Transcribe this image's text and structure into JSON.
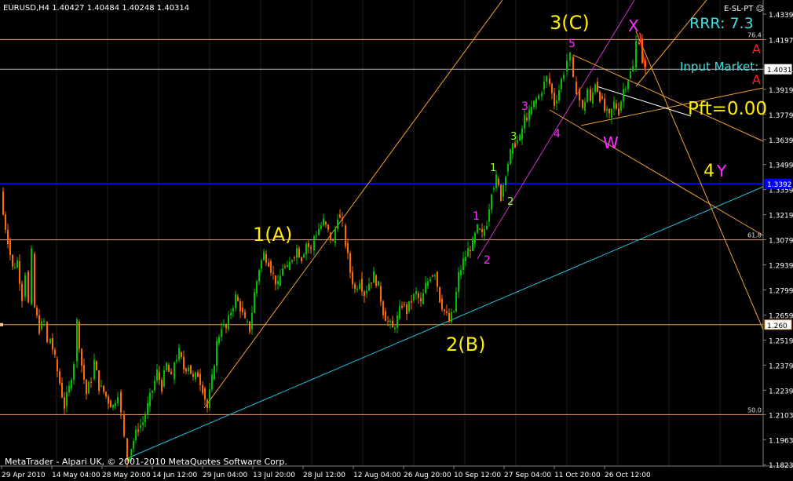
{
  "header": {
    "symbol_info": "EURUSD,H4  1.40427 1.40484 1.40248 1.40314",
    "indicator_label": "E-SL-PT ☺"
  },
  "rrr_label": "RRR: 7.3",
  "input_market_label": "Input Market:",
  "pft_label": "Pft=0.00",
  "watermark": "MetaTrader - Alpari UK, © 2001-2010 MetaQuotes Software Corp.",
  "colors": {
    "background": "#000000",
    "grid": "#1e1e1e",
    "bull_candle": "#00c000",
    "bear_candle": "#ff6a00",
    "fib_line": "#e9a07a",
    "support_line": "#20c0e0",
    "channel_line": "#f0a030",
    "magenta_line": "#d030d0",
    "blue_level": "#0000ff",
    "wave_major": "#ffee00",
    "wave_minor": "#ff30ff",
    "wave_green": "#90ff30",
    "arrow_red": "#ff2020",
    "rrr": "#40e0e0"
  },
  "chart_data": {
    "type": "candlestick",
    "symbol": "EURUSD",
    "timeframe": "H4",
    "ohlc_last": {
      "open": 1.40427,
      "high": 1.40484,
      "low": 1.40248,
      "close": 1.40314
    },
    "ylim": [
      1.1824,
      1.4339
    ],
    "y_ticks": [
      "1.43390",
      "1.41970",
      "1.40314",
      "1.39190",
      "1.37790",
      "1.36390",
      "1.34990",
      "1.33590",
      "1.32190",
      "1.30790",
      "1.29390",
      "1.27990",
      "1.26590",
      "1.25190",
      "1.23790",
      "1.22390",
      "1.21030",
      "1.19630",
      "1.18230"
    ],
    "x_ticks": [
      "29 Apr 2010",
      "14 May 04:00",
      "28 May 20:00",
      "14 Jun 12:00",
      "29 Jun 04:00",
      "13 Jul 20:00",
      "28 Jul 12:00",
      "12 Aug 04:00",
      "26 Aug 20:00",
      "10 Sep 12:00",
      "27 Sep 04:00",
      "11 Oct 20:00",
      "26 Oct 12:00"
    ],
    "price_path": [
      [
        0,
        1.335
      ],
      [
        4,
        1.322
      ],
      [
        10,
        1.308
      ],
      [
        16,
        1.292
      ],
      [
        22,
        1.296
      ],
      [
        28,
        1.276
      ],
      [
        32,
        1.29
      ],
      [
        36,
        1.272
      ],
      [
        40,
        1.3
      ],
      [
        44,
        1.27
      ],
      [
        50,
        1.258
      ],
      [
        56,
        1.262
      ],
      [
        60,
        1.25
      ],
      [
        64,
        1.253
      ],
      [
        70,
        1.241
      ],
      [
        76,
        1.228
      ],
      [
        82,
        1.215
      ],
      [
        88,
        1.225
      ],
      [
        94,
        1.24
      ],
      [
        98,
        1.262
      ],
      [
        104,
        1.238
      ],
      [
        110,
        1.222
      ],
      [
        116,
        1.23
      ],
      [
        120,
        1.24
      ],
      [
        126,
        1.226
      ],
      [
        132,
        1.223
      ],
      [
        138,
        1.218
      ],
      [
        144,
        1.215
      ],
      [
        150,
        1.223
      ],
      [
        154,
        1.21
      ],
      [
        158,
        1.197
      ],
      [
        162,
        1.185
      ],
      [
        170,
        1.196
      ],
      [
        176,
        1.203
      ],
      [
        182,
        1.206
      ],
      [
        188,
        1.215
      ],
      [
        194,
        1.224
      ],
      [
        200,
        1.234
      ],
      [
        206,
        1.226
      ],
      [
        212,
        1.238
      ],
      [
        218,
        1.23
      ],
      [
        222,
        1.24
      ],
      [
        228,
        1.245
      ],
      [
        234,
        1.236
      ],
      [
        240,
        1.238
      ],
      [
        246,
        1.23
      ],
      [
        252,
        1.233
      ],
      [
        258,
        1.225
      ],
      [
        264,
        1.214
      ],
      [
        270,
        1.23
      ],
      [
        276,
        1.25
      ],
      [
        282,
        1.26
      ],
      [
        288,
        1.258
      ],
      [
        294,
        1.268
      ],
      [
        300,
        1.276
      ],
      [
        306,
        1.27
      ],
      [
        312,
        1.262
      ],
      [
        318,
        1.258
      ],
      [
        324,
        1.278
      ],
      [
        330,
        1.292
      ],
      [
        336,
        1.3
      ],
      [
        342,
        1.296
      ],
      [
        348,
        1.288
      ],
      [
        354,
        1.282
      ],
      [
        360,
        1.293
      ],
      [
        366,
        1.291
      ],
      [
        372,
        1.298
      ],
      [
        378,
        1.303
      ],
      [
        384,
        1.298
      ],
      [
        390,
        1.306
      ],
      [
        396,
        1.302
      ],
      [
        400,
        1.31
      ],
      [
        406,
        1.314
      ],
      [
        412,
        1.318
      ],
      [
        418,
        1.312
      ],
      [
        424,
        1.306
      ],
      [
        430,
        1.322
      ],
      [
        436,
        1.316
      ],
      [
        440,
        1.306
      ],
      [
        446,
        1.29
      ],
      [
        452,
        1.28
      ],
      [
        458,
        1.286
      ],
      [
        464,
        1.278
      ],
      [
        470,
        1.284
      ],
      [
        476,
        1.288
      ],
      [
        482,
        1.282
      ],
      [
        488,
        1.268
      ],
      [
        494,
        1.262
      ],
      [
        500,
        1.258
      ],
      [
        506,
        1.264
      ],
      [
        512,
        1.272
      ],
      [
        518,
        1.268
      ],
      [
        524,
        1.274
      ],
      [
        530,
        1.278
      ],
      [
        536,
        1.272
      ],
      [
        542,
        1.282
      ],
      [
        548,
        1.288
      ],
      [
        554,
        1.29
      ],
      [
        560,
        1.275
      ],
      [
        566,
        1.268
      ],
      [
        572,
        1.262
      ],
      [
        578,
        1.268
      ],
      [
        584,
        1.288
      ],
      [
        590,
        1.296
      ],
      [
        596,
        1.302
      ],
      [
        602,
        1.306
      ],
      [
        608,
        1.314
      ],
      [
        614,
        1.31
      ],
      [
        620,
        1.318
      ],
      [
        626,
        1.336
      ],
      [
        632,
        1.342
      ],
      [
        638,
        1.332
      ],
      [
        644,
        1.346
      ],
      [
        650,
        1.356
      ],
      [
        656,
        1.362
      ],
      [
        662,
        1.364
      ],
      [
        668,
        1.376
      ],
      [
        674,
        1.378
      ],
      [
        680,
        1.384
      ],
      [
        686,
        1.388
      ],
      [
        690,
        1.392
      ],
      [
        696,
        1.398
      ],
      [
        700,
        1.395
      ],
      [
        706,
        1.384
      ],
      [
        712,
        1.392
      ],
      [
        718,
        1.402
      ],
      [
        722,
        1.408
      ],
      [
        726,
        1.41
      ],
      [
        730,
        1.396
      ],
      [
        734,
        1.392
      ],
      [
        738,
        1.386
      ],
      [
        742,
        1.38
      ],
      [
        748,
        1.392
      ],
      [
        752,
        1.384
      ],
      [
        758,
        1.396
      ],
      [
        764,
        1.388
      ],
      [
        770,
        1.38
      ],
      [
        776,
        1.376
      ],
      [
        782,
        1.384
      ],
      [
        788,
        1.38
      ],
      [
        794,
        1.392
      ],
      [
        800,
        1.398
      ],
      [
        806,
        1.404
      ],
      [
        810,
        1.418
      ],
      [
        814,
        1.42
      ],
      [
        818,
        1.408
      ],
      [
        822,
        1.403
      ]
    ]
  },
  "levels": [
    {
      "label": "76.4",
      "price": 1.4197
    },
    {
      "label": "61.8",
      "price": 1.3079
    },
    {
      "label": "50.0",
      "price": 1.2103
    }
  ],
  "price_markers": [
    {
      "label": "1.40314",
      "price": 1.40314
    },
    {
      "label": "1.260",
      "price": 1.2605
    },
    {
      "label": "1.3392",
      "price": 1.3392
    }
  ],
  "wave_labels": [
    {
      "text": "1(A)",
      "kind": "major"
    },
    {
      "text": "2(B)",
      "kind": "major"
    },
    {
      "text": "3(C)",
      "kind": "major"
    },
    {
      "text": "4",
      "kind": "major"
    },
    {
      "text": "Y",
      "kind": "minor"
    },
    {
      "text": "X",
      "kind": "minor"
    },
    {
      "text": "W",
      "kind": "minor"
    },
    {
      "text": "1",
      "kind": "minor"
    },
    {
      "text": "2",
      "kind": "minor"
    },
    {
      "text": "3",
      "kind": "minor"
    },
    {
      "text": "4",
      "kind": "minor"
    },
    {
      "text": "5",
      "kind": "minor"
    },
    {
      "text": "1",
      "kind": "green"
    },
    {
      "text": "2",
      "kind": "green"
    },
    {
      "text": "3",
      "kind": "green"
    },
    {
      "text": "A",
      "kind": "arrow"
    },
    {
      "text": "A",
      "kind": "arrow"
    }
  ]
}
